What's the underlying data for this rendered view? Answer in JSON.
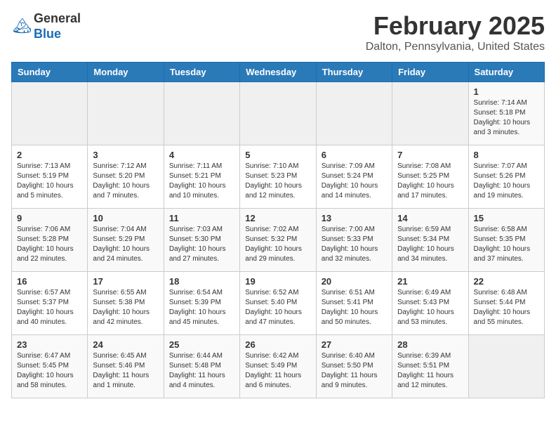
{
  "header": {
    "logo_line1": "General",
    "logo_line2": "Blue",
    "title": "February 2025",
    "subtitle": "Dalton, Pennsylvania, United States"
  },
  "weekdays": [
    "Sunday",
    "Monday",
    "Tuesday",
    "Wednesday",
    "Thursday",
    "Friday",
    "Saturday"
  ],
  "weeks": [
    [
      {
        "day": "",
        "info": ""
      },
      {
        "day": "",
        "info": ""
      },
      {
        "day": "",
        "info": ""
      },
      {
        "day": "",
        "info": ""
      },
      {
        "day": "",
        "info": ""
      },
      {
        "day": "",
        "info": ""
      },
      {
        "day": "1",
        "info": "Sunrise: 7:14 AM\nSunset: 5:18 PM\nDaylight: 10 hours and 3 minutes."
      }
    ],
    [
      {
        "day": "2",
        "info": "Sunrise: 7:13 AM\nSunset: 5:19 PM\nDaylight: 10 hours and 5 minutes."
      },
      {
        "day": "3",
        "info": "Sunrise: 7:12 AM\nSunset: 5:20 PM\nDaylight: 10 hours and 7 minutes."
      },
      {
        "day": "4",
        "info": "Sunrise: 7:11 AM\nSunset: 5:21 PM\nDaylight: 10 hours and 10 minutes."
      },
      {
        "day": "5",
        "info": "Sunrise: 7:10 AM\nSunset: 5:23 PM\nDaylight: 10 hours and 12 minutes."
      },
      {
        "day": "6",
        "info": "Sunrise: 7:09 AM\nSunset: 5:24 PM\nDaylight: 10 hours and 14 minutes."
      },
      {
        "day": "7",
        "info": "Sunrise: 7:08 AM\nSunset: 5:25 PM\nDaylight: 10 hours and 17 minutes."
      },
      {
        "day": "8",
        "info": "Sunrise: 7:07 AM\nSunset: 5:26 PM\nDaylight: 10 hours and 19 minutes."
      }
    ],
    [
      {
        "day": "9",
        "info": "Sunrise: 7:06 AM\nSunset: 5:28 PM\nDaylight: 10 hours and 22 minutes."
      },
      {
        "day": "10",
        "info": "Sunrise: 7:04 AM\nSunset: 5:29 PM\nDaylight: 10 hours and 24 minutes."
      },
      {
        "day": "11",
        "info": "Sunrise: 7:03 AM\nSunset: 5:30 PM\nDaylight: 10 hours and 27 minutes."
      },
      {
        "day": "12",
        "info": "Sunrise: 7:02 AM\nSunset: 5:32 PM\nDaylight: 10 hours and 29 minutes."
      },
      {
        "day": "13",
        "info": "Sunrise: 7:00 AM\nSunset: 5:33 PM\nDaylight: 10 hours and 32 minutes."
      },
      {
        "day": "14",
        "info": "Sunrise: 6:59 AM\nSunset: 5:34 PM\nDaylight: 10 hours and 34 minutes."
      },
      {
        "day": "15",
        "info": "Sunrise: 6:58 AM\nSunset: 5:35 PM\nDaylight: 10 hours and 37 minutes."
      }
    ],
    [
      {
        "day": "16",
        "info": "Sunrise: 6:57 AM\nSunset: 5:37 PM\nDaylight: 10 hours and 40 minutes."
      },
      {
        "day": "17",
        "info": "Sunrise: 6:55 AM\nSunset: 5:38 PM\nDaylight: 10 hours and 42 minutes."
      },
      {
        "day": "18",
        "info": "Sunrise: 6:54 AM\nSunset: 5:39 PM\nDaylight: 10 hours and 45 minutes."
      },
      {
        "day": "19",
        "info": "Sunrise: 6:52 AM\nSunset: 5:40 PM\nDaylight: 10 hours and 47 minutes."
      },
      {
        "day": "20",
        "info": "Sunrise: 6:51 AM\nSunset: 5:41 PM\nDaylight: 10 hours and 50 minutes."
      },
      {
        "day": "21",
        "info": "Sunrise: 6:49 AM\nSunset: 5:43 PM\nDaylight: 10 hours and 53 minutes."
      },
      {
        "day": "22",
        "info": "Sunrise: 6:48 AM\nSunset: 5:44 PM\nDaylight: 10 hours and 55 minutes."
      }
    ],
    [
      {
        "day": "23",
        "info": "Sunrise: 6:47 AM\nSunset: 5:45 PM\nDaylight: 10 hours and 58 minutes."
      },
      {
        "day": "24",
        "info": "Sunrise: 6:45 AM\nSunset: 5:46 PM\nDaylight: 11 hours and 1 minute."
      },
      {
        "day": "25",
        "info": "Sunrise: 6:44 AM\nSunset: 5:48 PM\nDaylight: 11 hours and 4 minutes."
      },
      {
        "day": "26",
        "info": "Sunrise: 6:42 AM\nSunset: 5:49 PM\nDaylight: 11 hours and 6 minutes."
      },
      {
        "day": "27",
        "info": "Sunrise: 6:40 AM\nSunset: 5:50 PM\nDaylight: 11 hours and 9 minutes."
      },
      {
        "day": "28",
        "info": "Sunrise: 6:39 AM\nSunset: 5:51 PM\nDaylight: 11 hours and 12 minutes."
      },
      {
        "day": "",
        "info": ""
      }
    ]
  ]
}
